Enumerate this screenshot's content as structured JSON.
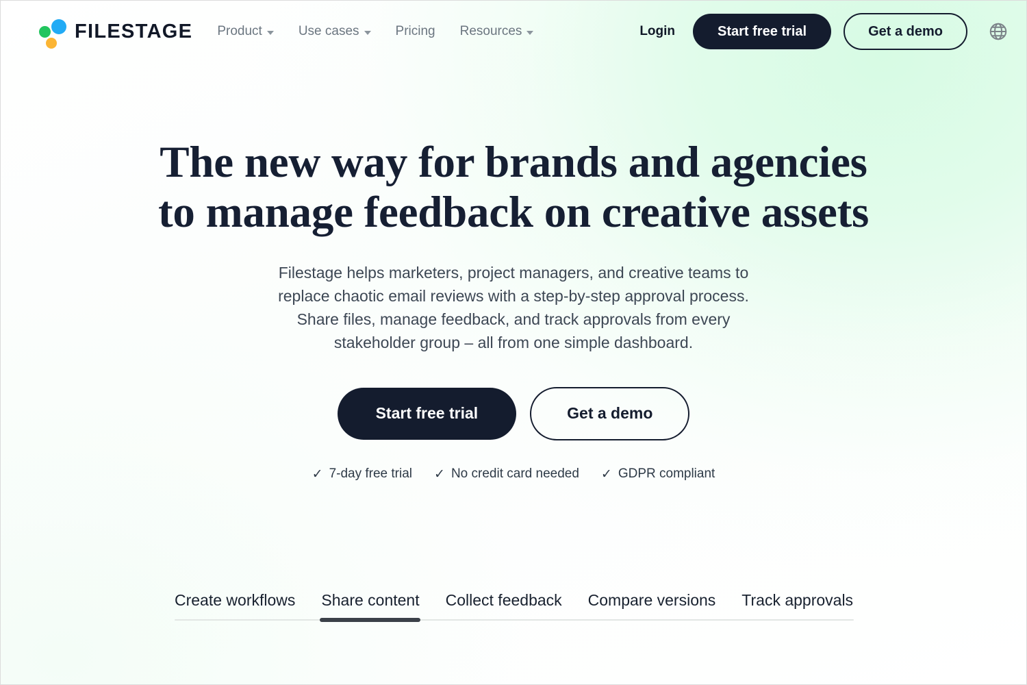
{
  "brand": {
    "name": "FILESTAGE",
    "logo_colors": {
      "green": "#22c55e",
      "blue": "#22abf5",
      "yellow": "#fbb534"
    }
  },
  "header": {
    "nav": [
      {
        "label": "Product",
        "has_dropdown": true
      },
      {
        "label": "Use cases",
        "has_dropdown": true
      },
      {
        "label": "Pricing",
        "has_dropdown": false
      },
      {
        "label": "Resources",
        "has_dropdown": true
      }
    ],
    "login_label": "Login",
    "trial_button": "Start free trial",
    "demo_button": "Get a demo",
    "language_icon": "globe-icon"
  },
  "hero": {
    "headline_line1": "The new way for brands and agencies",
    "headline_line2": "to manage feedback on creative assets",
    "subheadline": "Filestage helps marketers, project managers, and creative teams to replace chaotic email reviews with a step-by-step approval process. Share files, manage feedback, and track approvals from every stakeholder group – all from one simple dashboard.",
    "primary_cta": "Start free trial",
    "secondary_cta": "Get a demo",
    "trust_items": [
      {
        "check": "✓",
        "label": "7-day free trial"
      },
      {
        "check": "✓",
        "label": "No credit card needed"
      },
      {
        "check": "✓",
        "label": "GDPR compliant"
      }
    ]
  },
  "tabs": {
    "items": [
      {
        "label": "Create workflows",
        "active": false
      },
      {
        "label": "Share content",
        "active": true
      },
      {
        "label": "Collect feedback",
        "active": false
      },
      {
        "label": "Compare versions",
        "active": false
      },
      {
        "label": "Track approvals",
        "active": false
      }
    ],
    "active_index": 1
  },
  "colors": {
    "dark": "#141c2e",
    "accent_green": "#d7fbe4",
    "text_muted": "#6b7680",
    "headline": "#161f33"
  }
}
